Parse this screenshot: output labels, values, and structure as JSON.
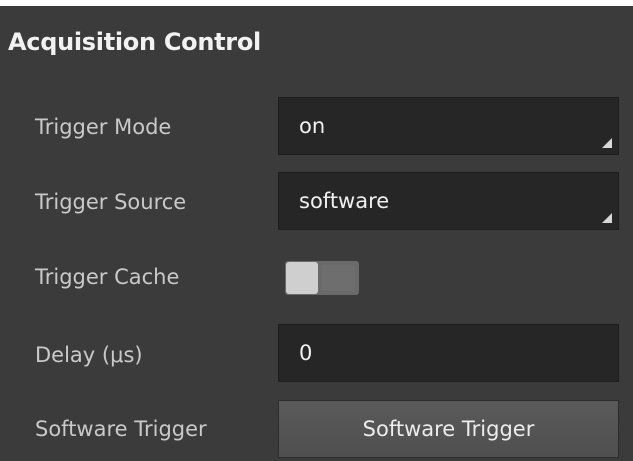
{
  "section": {
    "title": "Acquisition Control"
  },
  "rows": {
    "trigger_mode": {
      "label": "Trigger Mode",
      "value": "on"
    },
    "trigger_source": {
      "label": "Trigger Source",
      "value": "software"
    },
    "trigger_cache": {
      "label": "Trigger Cache",
      "enabled": false
    },
    "delay": {
      "label": "Delay (μs)",
      "value": "0"
    },
    "software_trigger": {
      "label": "Software Trigger",
      "button_label": "Software Trigger"
    }
  },
  "colors": {
    "panel_background": "#3b3b3b",
    "field_background": "#262626",
    "button_background": "#555555",
    "label_text": "#c9c9c9",
    "value_text": "#f0f0f0"
  },
  "icons": {
    "dropdown": "dropdown-corner-arrow-icon"
  }
}
